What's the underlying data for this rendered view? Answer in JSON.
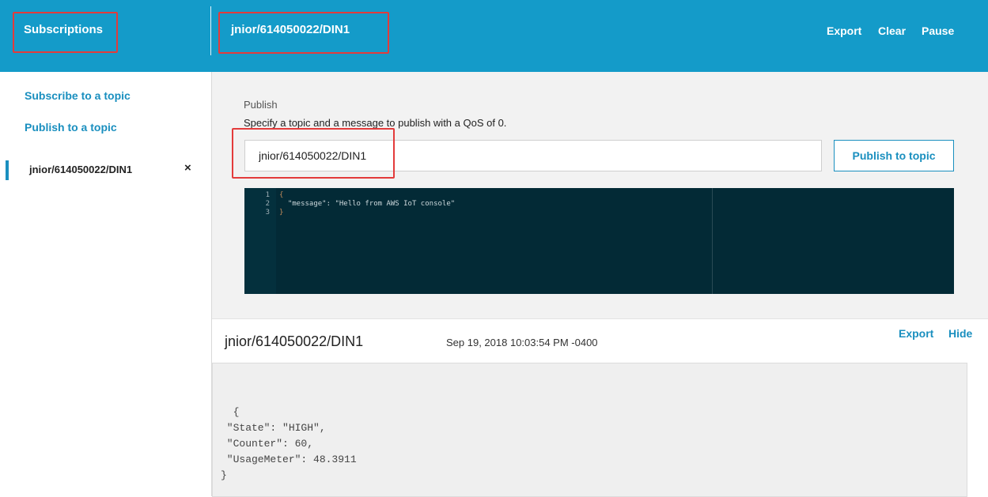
{
  "header": {
    "subscriptions_title": "Subscriptions",
    "current_topic": "jnior/614050022/DIN1",
    "actions": {
      "export": "Export",
      "clear": "Clear",
      "pause": "Pause"
    }
  },
  "sidebar": {
    "subscribe_link": "Subscribe to a topic",
    "publish_link": "Publish to a topic",
    "subscriptions": [
      {
        "topic": "jnior/614050022/DIN1",
        "remove_glyph": "×"
      }
    ]
  },
  "publish": {
    "label": "Publish",
    "description": "Specify a topic and a message to publish with a QoS of 0.",
    "topic_value": "jnior/614050022/DIN1",
    "button_label": "Publish to topic",
    "editor_lines": [
      {
        "num": "1",
        "text": "{"
      },
      {
        "num": "2",
        "text": "  \"message\": \"Hello from AWS IoT console\""
      },
      {
        "num": "3",
        "text": "}"
      }
    ]
  },
  "message": {
    "topic": "jnior/614050022/DIN1",
    "timestamp": "Sep 19, 2018 10:03:54 PM -0400",
    "export_label": "Export",
    "hide_label": "Hide",
    "payload": "  {\n \"State\": \"HIGH\",\n \"Counter\": 60,\n \"UsageMeter\": 48.3911\n}"
  },
  "colors": {
    "header_bg": "#149bc9",
    "accent": "#1a8fbf",
    "highlight_box": "#e33b3b",
    "editor_bg": "#032a36"
  }
}
